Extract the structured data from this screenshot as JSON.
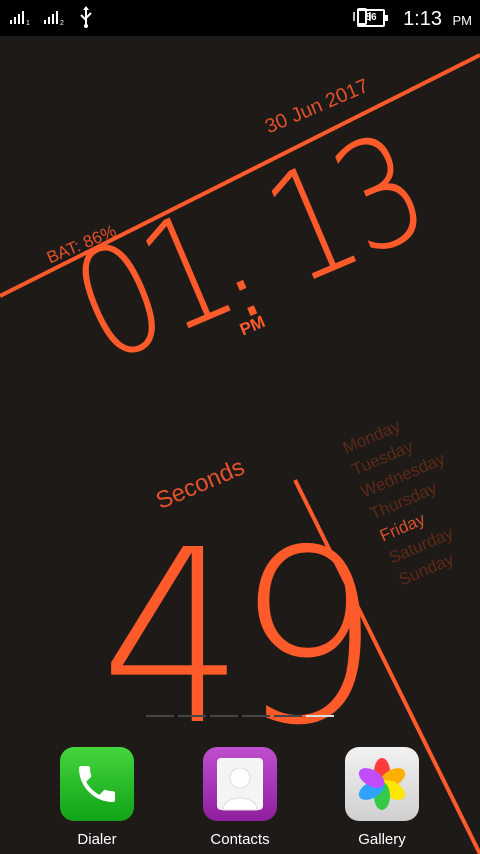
{
  "status_bar": {
    "time": "1:13",
    "ampm": "PM",
    "battery": "86",
    "icons": [
      "signal-sim1-icon",
      "signal-sim2-icon",
      "usb-icon",
      "vibrate-icon",
      "battery-icon"
    ]
  },
  "widget": {
    "date": "30 Jun 2017",
    "battery": "BAT: 86%",
    "hours": "01",
    "minutes": "13",
    "ampm": "PM",
    "seconds_label": "Seconds",
    "seconds": "49",
    "days": [
      "Monday",
      "Tuesday",
      "Wednesday",
      "Thursday",
      "Friday",
      "Saturday",
      "Sunday"
    ],
    "active_day": "Friday",
    "accent": "#ff5a2a"
  },
  "dock": {
    "apps": [
      {
        "label": "Dialer",
        "icon": "phone-icon",
        "color": "#2bbf2b"
      },
      {
        "label": "Contacts",
        "icon": "contact-icon",
        "color": "#a236b5"
      },
      {
        "label": "Gallery",
        "icon": "gallery-flower-icon",
        "color": "#d9d9d9"
      }
    ]
  }
}
